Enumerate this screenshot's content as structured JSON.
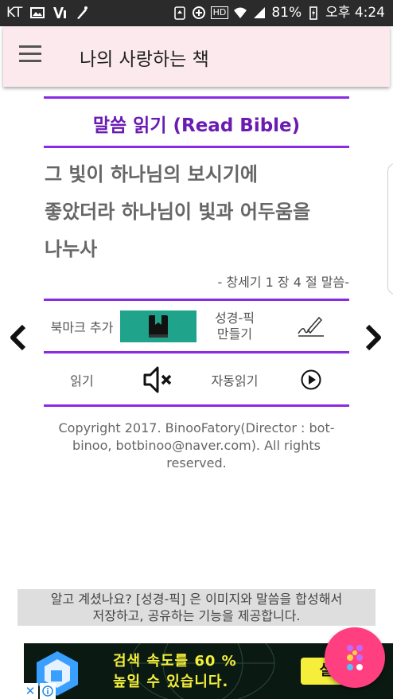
{
  "status_bar": {
    "carrier": "KT",
    "battery": "81%",
    "time": "오후 4:24",
    "hd_label": "HD"
  },
  "app_bar": {
    "title": "나의 사랑하는 책",
    "menu_icon": "hamburger-menu-icon"
  },
  "reading": {
    "section_title": "말씀 읽기 (Read Bible)",
    "verse_lines": [
      "그 빛이 하나님의 보시기에",
      "좋았더라 하나님이 빛과 어두움을",
      "나누사"
    ],
    "reference": "- 창세기 1 장 4 절 말씀-"
  },
  "actions": {
    "bookmark_label": "북마크 추가",
    "bible_pick_label_line1": "성경-픽",
    "bible_pick_label_line2": "만들기",
    "read_label": "읽기",
    "auto_read_label": "자동읽기"
  },
  "copyright": {
    "line1": "Copyright 2017. BinooFatory(Director : bot-",
    "line2": "binoo, botbinoo@naver.com). All rights",
    "line3": "reserved."
  },
  "info_bar": {
    "line1": "알고 계셨나요? [성경-픽] 은 이미지와 말씀을 합성해서",
    "line2": "저장하고, 공유하는 기능을 제공합니다."
  },
  "ad": {
    "line1": "검색 속도를 60 %",
    "line2": "높일 수 있습니다.",
    "cta": "설치"
  },
  "colors": {
    "accent_purple": "#8a2be2",
    "title_purple": "#6a1bb4",
    "bookmark_teal": "#1fa38a",
    "app_bar_bg": "#fbe9ee",
    "fab_pink": "#ff3f80",
    "ad_yellow": "#f5ee3a"
  }
}
